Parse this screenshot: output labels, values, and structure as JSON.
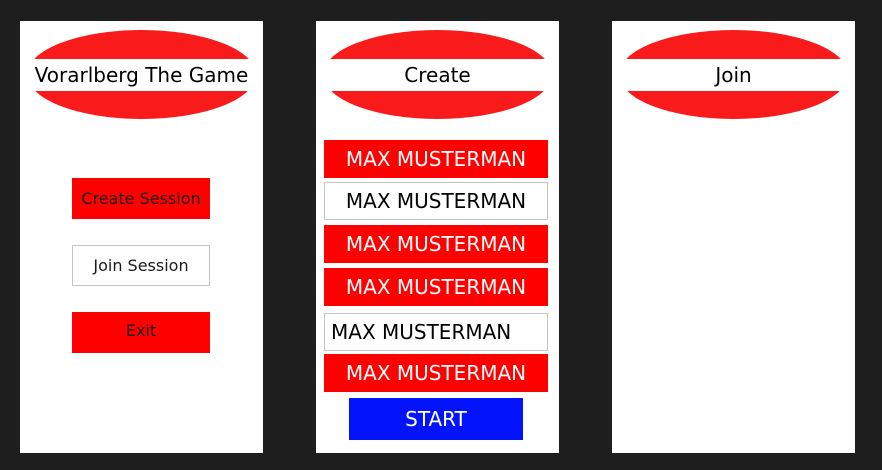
{
  "menu": {
    "title": "Vorarlberg The Game",
    "create_label": "Create Session",
    "join_label": "Join Session",
    "exit_label": "Exit"
  },
  "create": {
    "title": "Create",
    "players": [
      "MAX MUSTERMAN",
      "MAX MUSTERMAN",
      "MAX MUSTERMAN",
      "MAX MUSTERMAN",
      "MAX MUSTERMAN",
      "MAX MUSTERMAN"
    ],
    "start_label": "START"
  },
  "join": {
    "title": "Join"
  },
  "colors": {
    "background": "#1e1e1e",
    "frame": "#ffffff",
    "header_red": "#f91b1b",
    "button_red": "#ff0000",
    "start_blue": "#0313fc"
  }
}
